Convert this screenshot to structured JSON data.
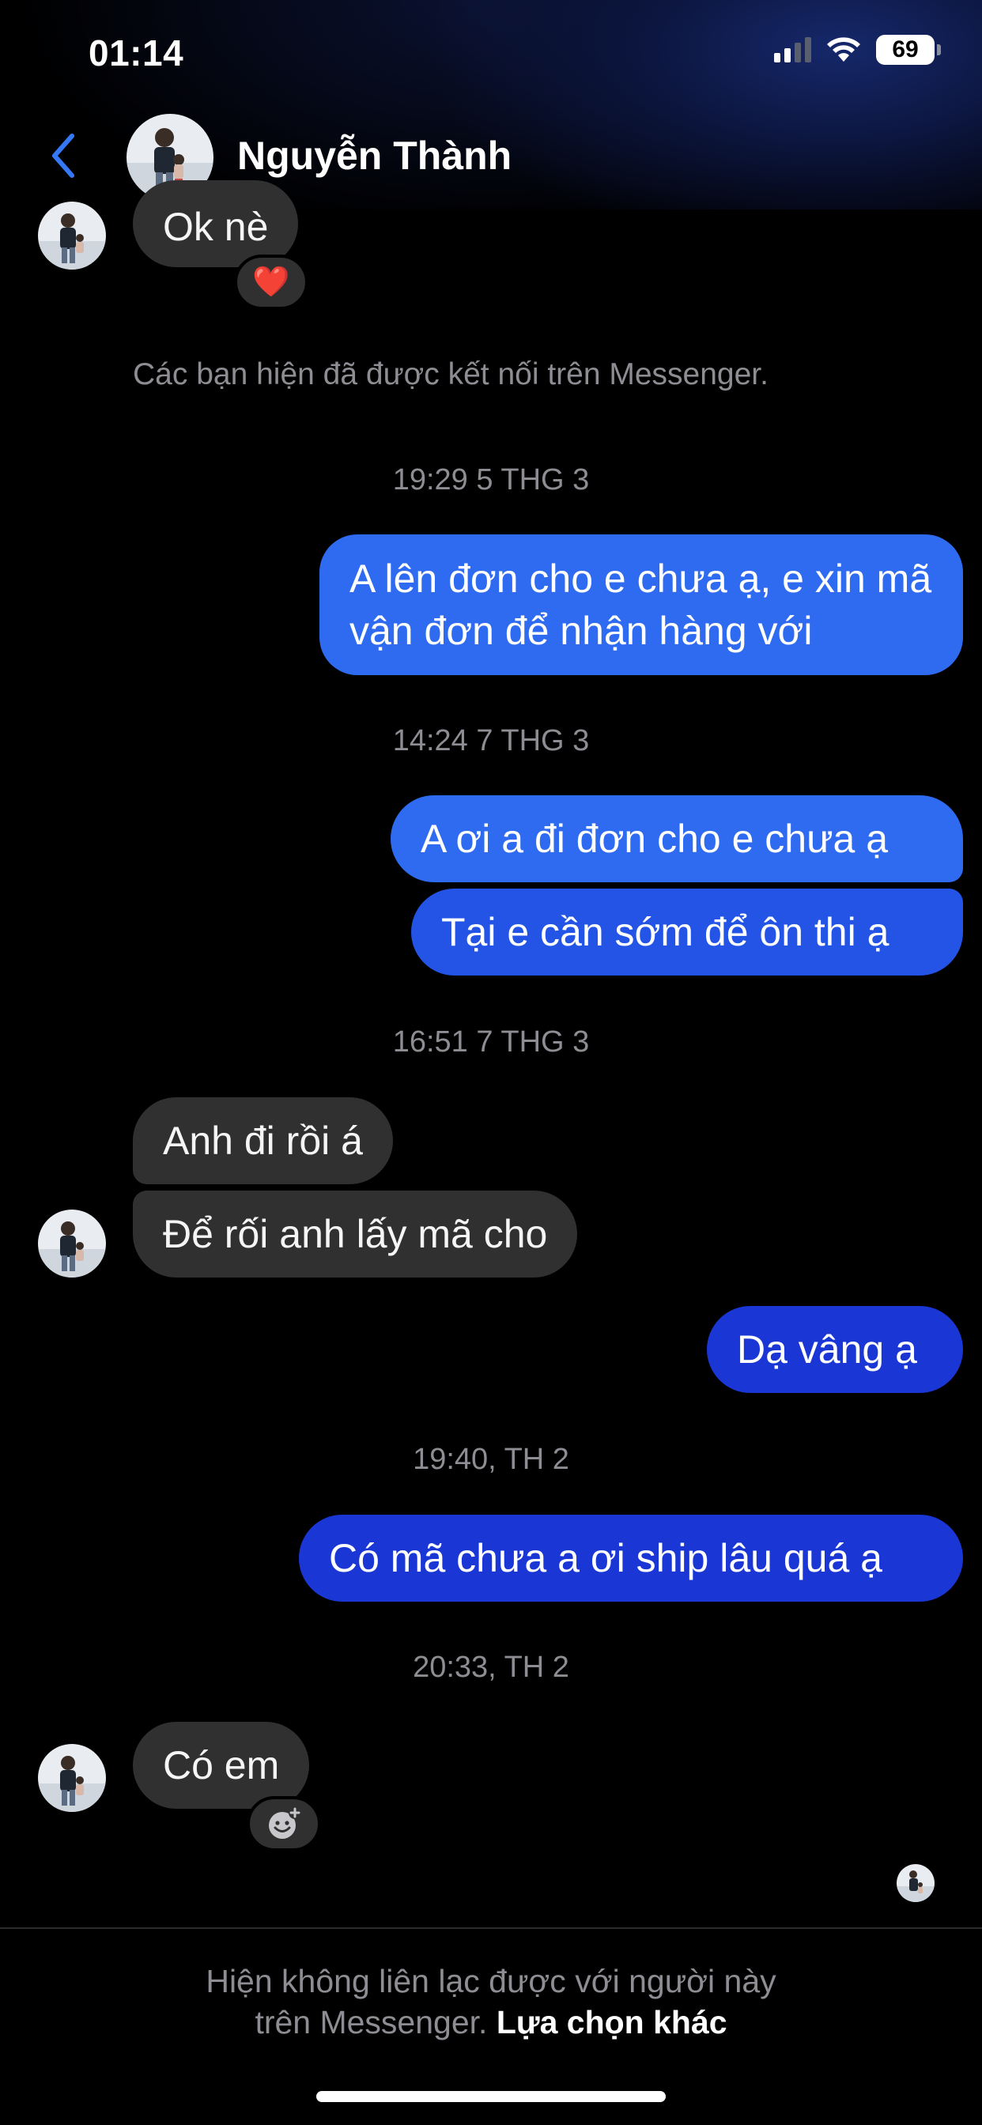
{
  "status_bar": {
    "time": "01:14",
    "battery": "69"
  },
  "header": {
    "contact_name": "Nguyễn Thành"
  },
  "messages": [
    {
      "kind": "in",
      "text": "Ok nè",
      "reaction": "❤️"
    },
    {
      "kind": "notice",
      "text": "Các bạn hiện đã được kết nối trên Messenger."
    },
    {
      "kind": "time",
      "text": "19:29 5 THG 3"
    },
    {
      "kind": "out",
      "text": "A lên đơn cho e chưa ạ, e xin mã vận đơn để nhận hàng với"
    },
    {
      "kind": "time",
      "text": "14:24 7 THG 3"
    },
    {
      "kind": "out",
      "text": "A ơi a đi đơn cho e chưa ạ"
    },
    {
      "kind": "out",
      "text": "Tại e cần sớm để ôn thi ạ"
    },
    {
      "kind": "time",
      "text": "16:51 7 THG 3"
    },
    {
      "kind": "in",
      "text": "Anh đi rồi á"
    },
    {
      "kind": "in",
      "text": "Để rối anh lấy mã cho"
    },
    {
      "kind": "out",
      "text": "Dạ vâng ạ"
    },
    {
      "kind": "time",
      "text": "19:40, TH 2"
    },
    {
      "kind": "out",
      "text": "Có mã chưa a ơi ship lâu quá ạ"
    },
    {
      "kind": "time",
      "text": "20:33, TH 2"
    },
    {
      "kind": "in",
      "text": "Có em"
    }
  ],
  "footer": {
    "text": "Hiện không liên lạc được với người này trên Messenger.",
    "link": "Lựa chọn khác"
  },
  "colors": {
    "background": "#000000",
    "incoming_bubble": "#303030",
    "outgoing_bubble_light": "#2f6bf0",
    "outgoing_bubble_dark": "#1a37d6",
    "accent": "#3478f6"
  }
}
